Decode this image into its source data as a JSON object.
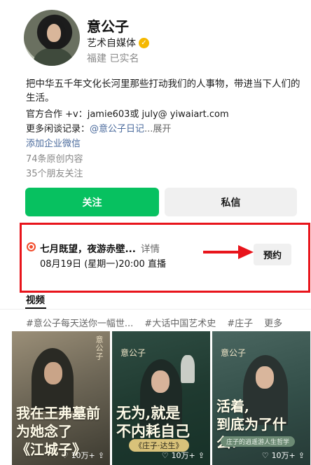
{
  "profile": {
    "name": "意公子",
    "role": "艺术自媒体",
    "location": "福建 已实名"
  },
  "bio": {
    "text": "把中华五千年文化长河里那些打动我们的人事物，带进当下人们的生活。",
    "contact": "官方合作 +v：jamie603或 july@ yiwaiart.com",
    "more_prefix": "更多闲谈记录：",
    "more_link": "@意公子日记",
    "more_expand": "...展开",
    "enterprise_wechat": "添加企业微信",
    "original_count": "74条原创内容",
    "friends_following": "35个朋友关注"
  },
  "actions": {
    "follow_label": "关注",
    "message_label": "私信"
  },
  "live_notice": {
    "title": "七月既望，夜游赤壁...",
    "detail_label": "详情",
    "time": "08月19日 (星期一)20:00 直播",
    "book_label": "预约"
  },
  "tabs": {
    "video_label": "视频"
  },
  "tags": [
    "#意公子每天送你一幅世...",
    "#大话中国艺术史",
    "#庄子",
    "更多"
  ],
  "videos": [
    {
      "deco": "意公子",
      "title_line1": "我在王弗墓前",
      "title_line2": "为她念了",
      "title_line3": "《江城子》",
      "views": "10万+"
    },
    {
      "logo": "意公子",
      "title_line1": "无为,就是",
      "title_line2": "不内耗自己",
      "tag": "《庄子·达生》",
      "views": "10万+"
    },
    {
      "logo": "意公子",
      "title_line1": "活着,",
      "title_line2": "到底为了什么?",
      "tag": "庄子的逍遥游人生哲学",
      "views": "10万+"
    }
  ],
  "colors": {
    "accent_green": "#07c160",
    "live_red": "#f24b2b",
    "highlight_red": "#e8141b",
    "link_blue": "#4a6a9c"
  }
}
